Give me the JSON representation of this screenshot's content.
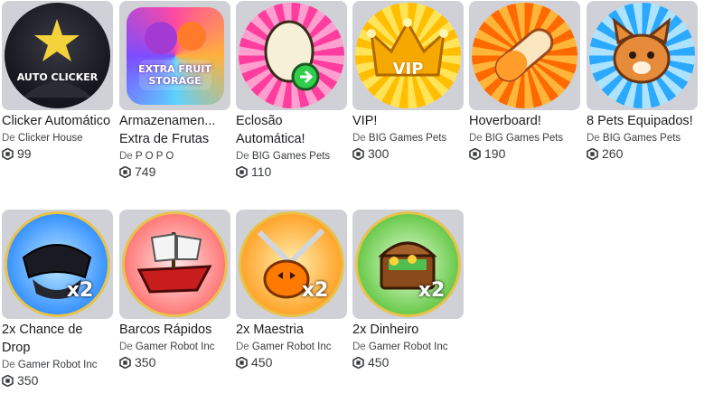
{
  "items": [
    {
      "title": "Clicker Automático",
      "creator_prefix": "De",
      "creator": "Clicker House",
      "price": "99",
      "icon": "auto-clicker-icon",
      "badge_text": "AUTO CLICKER",
      "colors": [
        "#1c1c24",
        "#3a3a46"
      ]
    },
    {
      "title": "Armazenamen...Extra de Frutas",
      "creator_prefix": "De",
      "creator": "P O P O",
      "price": "749",
      "icon": "extra-fruit-storage-icon",
      "badge_text": "EXTRA FRUIT STORAGE",
      "colors": [
        "#b23dd6",
        "#3fd0e8"
      ]
    },
    {
      "title": "Eclosão Automática!",
      "creator_prefix": "De",
      "creator": "BIG Games Pets",
      "price": "110",
      "icon": "egg-icon",
      "badge_text": "",
      "colors": [
        "#ff4fa8",
        "#ffd6ec"
      ]
    },
    {
      "title": "VIP!",
      "creator_prefix": "De",
      "creator": "BIG Games Pets",
      "price": "300",
      "icon": "vip-crown-icon",
      "badge_text": "VIP",
      "colors": [
        "#ffb300",
        "#fff06a"
      ]
    },
    {
      "title": "Hoverboard!",
      "creator_prefix": "De",
      "creator": "BIG Games Pets",
      "price": "190",
      "icon": "hoverboard-icon",
      "badge_text": "",
      "colors": [
        "#ff6a00",
        "#ffd24a"
      ]
    },
    {
      "title": "8 Pets Equipados!",
      "creator_prefix": "De",
      "creator": "BIG Games Pets",
      "price": "260",
      "icon": "pet-icon",
      "badge_text": "",
      "colors": [
        "#2aa9ff",
        "#c6ecff"
      ]
    },
    {
      "title": "2x Chance de Drop",
      "creator_prefix": "De",
      "creator": "Gamer Robot Inc",
      "price": "350",
      "icon": "pirate-hat-icon",
      "badge_text": "x2",
      "colors": [
        "#1e73ff",
        "#9fdcff"
      ]
    },
    {
      "title": "Barcos Rápidos",
      "creator_prefix": "De",
      "creator": "Gamer Robot Inc",
      "price": "350",
      "icon": "pirate-ship-icon",
      "badge_text": "",
      "colors": [
        "#ff5a5a",
        "#ffd0d0"
      ]
    },
    {
      "title": "2x Maestria",
      "creator_prefix": "De",
      "creator": "Gamer Robot Inc",
      "price": "450",
      "icon": "swords-pumpkin-icon",
      "badge_text": "x2",
      "colors": [
        "#ff8c00",
        "#ffe08a"
      ]
    },
    {
      "title": "2x Dinheiro",
      "creator_prefix": "De",
      "creator": "Gamer Robot Inc",
      "price": "450",
      "icon": "treasure-chest-icon",
      "badge_text": "x2",
      "colors": [
        "#38b24a",
        "#c9f0b0"
      ]
    }
  ],
  "price_icon": "robux-icon"
}
